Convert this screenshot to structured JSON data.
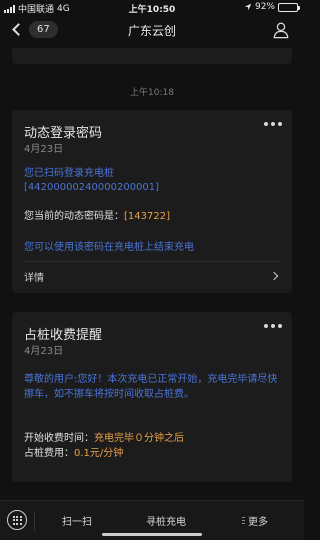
{
  "status_bar": {
    "carrier": "中国联通",
    "network": "4G",
    "time": "上午10:50",
    "battery": "92%",
    "battery_level": 0.92
  },
  "nav": {
    "back_count": "67",
    "title": "广东云创"
  },
  "timestamp": "上午10:18",
  "card1": {
    "title": "动态登录密码",
    "date": "4月23日",
    "line1": "您已扫码登录充电桩",
    "line2": "[44200000240000200001]",
    "code_label": "您当前的动态密码是：",
    "code_value": "[143722]",
    "hint": "您可以使用该密码在充电桩上结束充电",
    "details": "详情"
  },
  "card2": {
    "title": "占桩收费提醒",
    "date": "4月23日",
    "notice": "尊敬的用户:您好！本次充电已正常开始，充电完毕请尽快挪车，如不挪车将按时间收取占桩费。",
    "start_label": "开始收费时间：",
    "start_value": "充电完毕０分钟之后",
    "fee_label": "占桩费用：",
    "fee_value": "0.1元/分钟"
  },
  "bottom_bar": {
    "tab1": "扫一扫",
    "tab2": "寻桩充电",
    "tab3": "更多"
  },
  "colors": {
    "background": "#111111",
    "card": "#1c1c1c",
    "link": "#4a74d8",
    "accent": "#e8a046"
  }
}
